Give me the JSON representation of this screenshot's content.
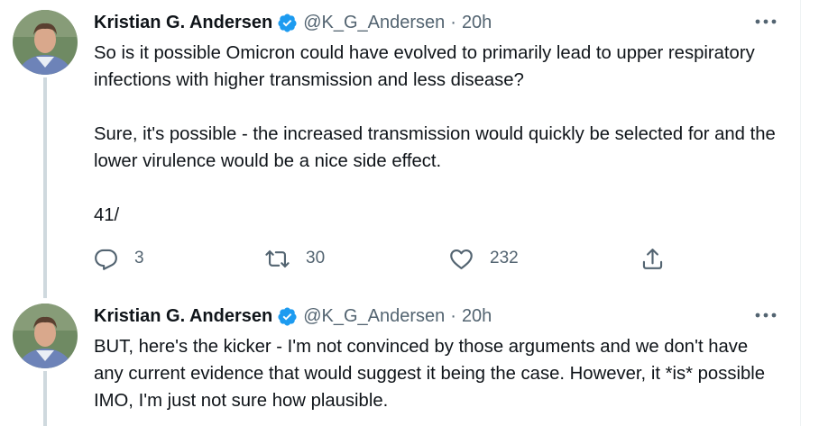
{
  "tweets": [
    {
      "author": "Kristian G. Andersen",
      "handle": "@K_G_Andersen",
      "separator": "·",
      "time": "20h",
      "paragraphs": [
        "So is it possible Omicron could have evolved to primarily lead to upper respiratory infections with higher transmission and less disease?",
        "Sure, it's possible - the increased transmission would quickly be selected for and the lower virulence would be a nice side effect.",
        "41/"
      ],
      "replies": "3",
      "retweets": "30",
      "likes": "232"
    },
    {
      "author": "Kristian G. Andersen",
      "handle": "@K_G_Andersen",
      "separator": "·",
      "time": "20h",
      "paragraphs": [
        "BUT, here's the kicker - I'm not convinced by those arguments and we don't have any current evidence that would suggest it being the case. However, it *is* possible IMO, I'm just not sure how plausible."
      ]
    }
  ],
  "icons": {
    "verified": "verified-badge-icon",
    "more": "more-options-icon",
    "reply": "reply-icon",
    "retweet": "retweet-icon",
    "like": "heart-icon",
    "share": "share-icon"
  },
  "colors": {
    "text": "#0f1419",
    "secondary": "#536471",
    "verified": "#1d9bf0",
    "thread_line": "#cfd9de"
  }
}
